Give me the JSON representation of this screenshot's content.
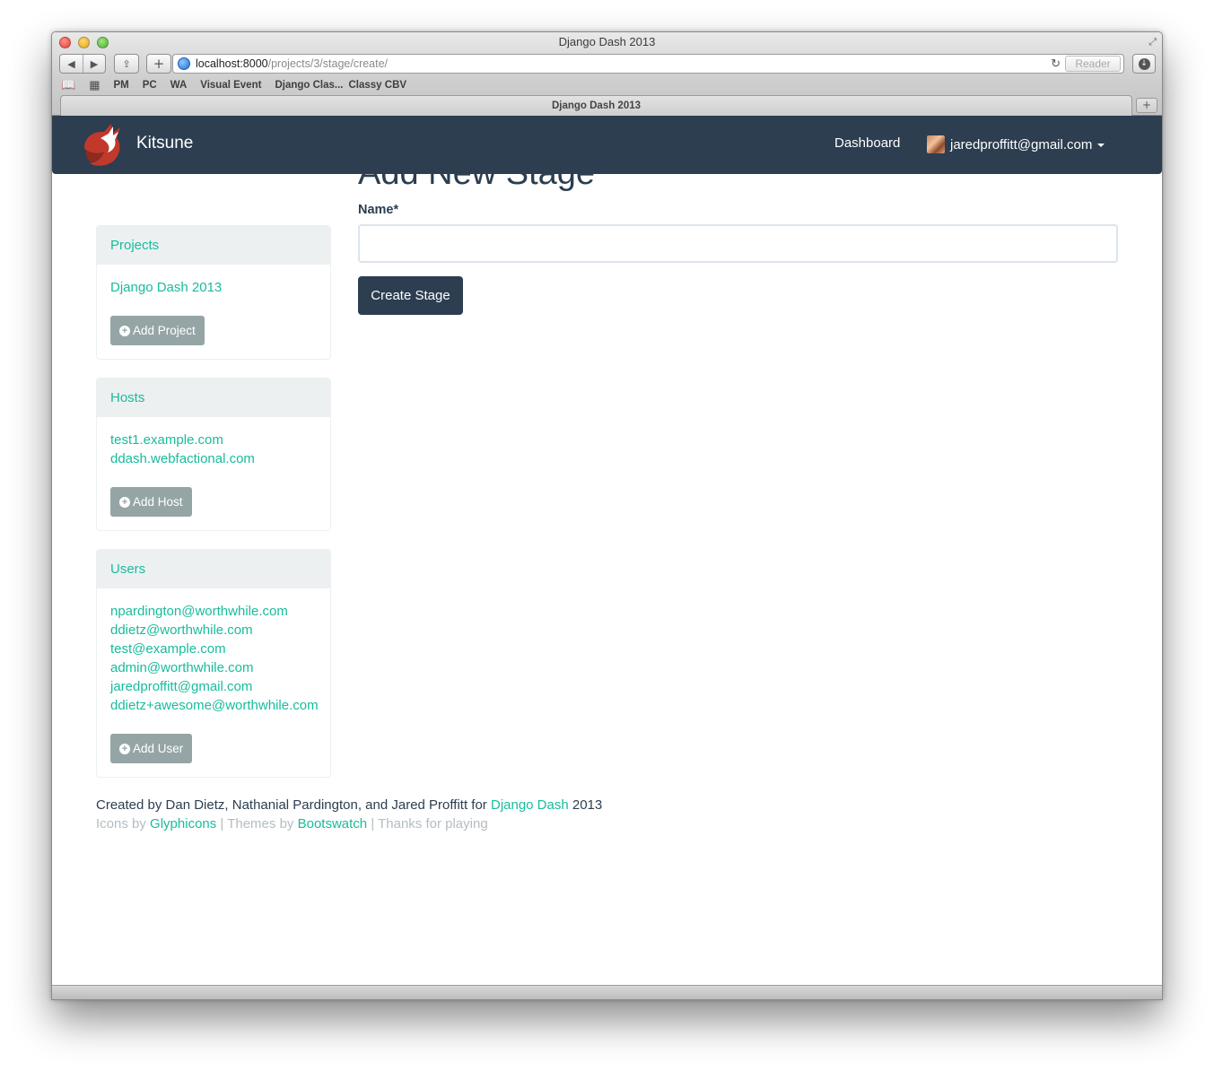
{
  "window": {
    "title": "Django Dash 2013",
    "url_host": "localhost:8000",
    "url_path": "/projects/3/stage/create/",
    "reader_label": "Reader",
    "bookmarks": [
      "PM",
      "PC",
      "WA",
      "Visual Event",
      "Django Clas...",
      "Classy CBV"
    ],
    "tab_title": "Django Dash 2013"
  },
  "navbar": {
    "brand": "Kitsune",
    "dashboard": "Dashboard",
    "user_email": "jaredproffitt@gmail.com"
  },
  "sidebar": {
    "projects": {
      "heading": "Projects",
      "items": [
        "Django Dash 2013"
      ],
      "button": "Add Project"
    },
    "hosts": {
      "heading": "Hosts",
      "items": [
        "test1.example.com",
        "ddash.webfactional.com"
      ],
      "button": "Add Host"
    },
    "users": {
      "heading": "Users",
      "items": [
        "npardington@worthwhile.com",
        "ddietz@worthwhile.com",
        "test@example.com",
        "admin@worthwhile.com",
        "jaredproffitt@gmail.com",
        "ddietz+awesome@worthwhile.com"
      ],
      "button": "Add User"
    }
  },
  "main": {
    "title": "Add New Stage",
    "name_label": "Name*",
    "name_value": "",
    "submit": "Create Stage"
  },
  "footer": {
    "created_prefix": "Created by Dan Dietz, Nathanial Pardington, and Jared Proffitt for",
    "created_link": "Django Dash",
    "created_suffix": "2013",
    "icons_prefix": "Icons by",
    "icons_link": "Glyphicons",
    "themes_prefix": "| Themes by",
    "themes_link": "Bootswatch",
    "thanks": "| Thanks for playing"
  },
  "colors": {
    "navbar": "#2c3e50",
    "accent": "#18bc9c",
    "button_gray": "#95a5a6",
    "panel_heading": "#ecf0f1"
  }
}
